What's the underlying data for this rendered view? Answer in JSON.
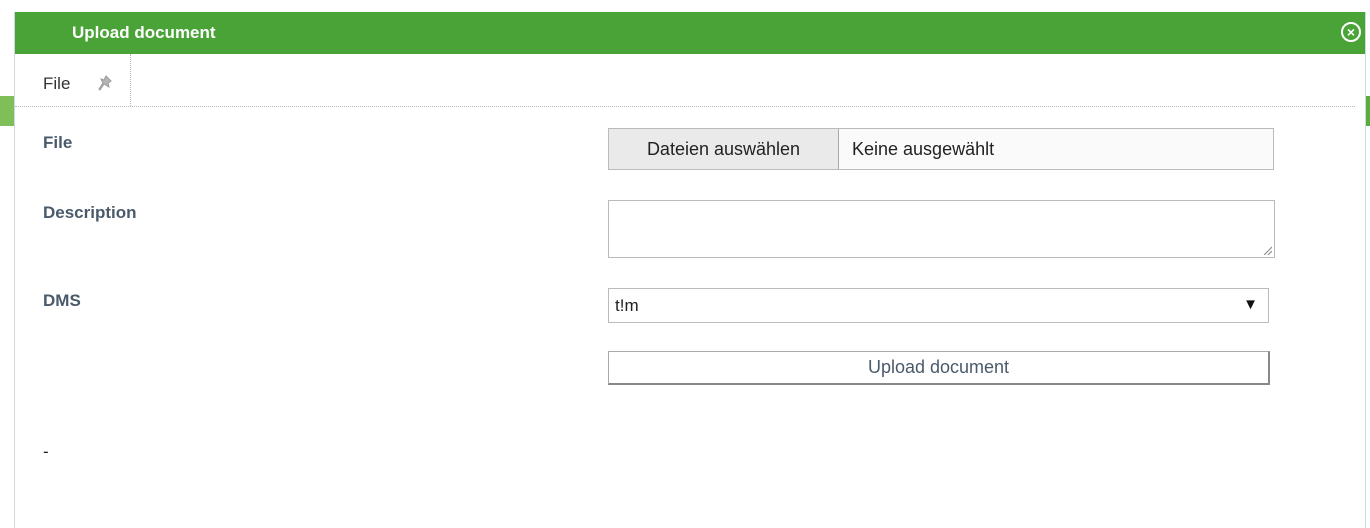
{
  "dialog": {
    "title": "Upload document",
    "close_icon": "close-circle-icon"
  },
  "tabs": [
    {
      "label": "File",
      "icon": "pin-icon"
    }
  ],
  "form": {
    "file_label": "File",
    "file_button": "Dateien auswählen",
    "file_status": "Keine ausgewählt",
    "description_label": "Description",
    "description_value": "",
    "dms_label": "DMS",
    "dms_selected": "t!m",
    "upload_button": "Upload document"
  },
  "footer_text": "-",
  "colors": {
    "titlebar": "#4aa336",
    "label_text": "#4a5a6a"
  }
}
